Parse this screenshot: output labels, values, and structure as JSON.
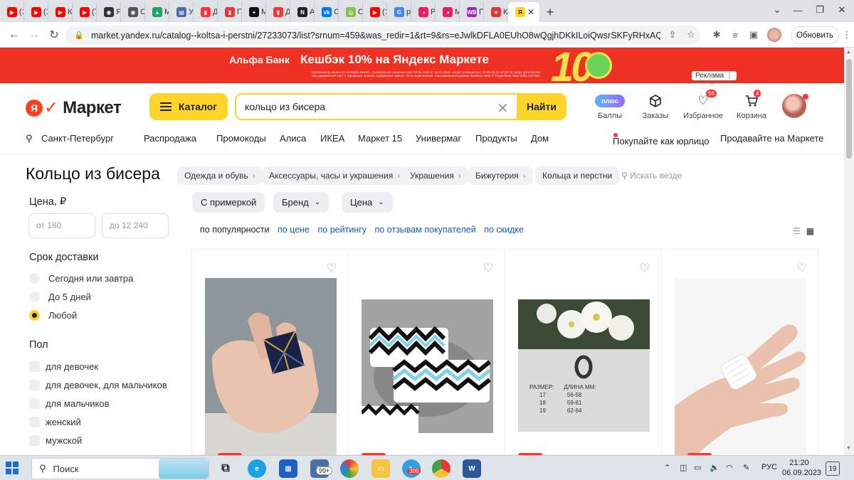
{
  "browser": {
    "tabs": [
      {
        "label": "(1",
        "color": "#ff0000",
        "glyph": "▶"
      },
      {
        "label": "(1",
        "color": "#ff0000",
        "glyph": "▶"
      },
      {
        "label": "Ки",
        "color": "#ff0000",
        "glyph": "▶"
      },
      {
        "label": "(7",
        "color": "#ff0000",
        "glyph": "▶"
      },
      {
        "label": "Ян",
        "color": "#333333",
        "glyph": "◉"
      },
      {
        "label": "Ст",
        "color": "#555555",
        "glyph": "◉"
      },
      {
        "label": "Мо",
        "color": "#1fa463",
        "glyph": "▲"
      },
      {
        "label": "Ус",
        "color": "#4a6fa5",
        "glyph": "▤"
      },
      {
        "label": "Дз",
        "color": "#ff3333",
        "glyph": "▮"
      },
      {
        "label": "П",
        "color": "#e53935",
        "glyph": "▮"
      },
      {
        "label": "М",
        "color": "#111111",
        "glyph": "+"
      },
      {
        "label": "Дз",
        "color": "#ff3333",
        "glyph": "▮"
      },
      {
        "label": "Ал",
        "color": "#222222",
        "glyph": "N"
      },
      {
        "label": "Ог",
        "color": "#0077ff",
        "glyph": "vk"
      },
      {
        "label": "Сл",
        "color": "#8bc34a",
        "glyph": "◎"
      },
      {
        "label": "(1",
        "color": "#ff0000",
        "glyph": "▶"
      },
      {
        "label": "pl",
        "color": "#4285f4",
        "glyph": "G"
      },
      {
        "label": "PI",
        "color": "#e91e63",
        "glyph": "◑"
      },
      {
        "label": "Мо",
        "color": "#e91e63",
        "glyph": "◑"
      },
      {
        "label": "Пл",
        "color": "#9c27b0",
        "glyph": "WB"
      },
      {
        "label": "Ку",
        "color": "#e53935",
        "glyph": "♥"
      }
    ],
    "active_tab_glyph": "Я",
    "new_tab": "+",
    "url": "market.yandex.ru/catalog--koltsa-i-perstni/27233073/list?srnum=459&was_redir=1&rt=9&rs=eJwlkDFLA0EUhO8wQgjhDKkILoiQwsrSKFyRHxAQG...",
    "update_label": "Обновить"
  },
  "banner": {
    "bank": "Альфа Банк",
    "headline": "Кешбэк 10% на Яндекс Маркете",
    "fine_print": "Организатор акции АО «АЛЬФА-БАНК». Генеральная лицензия ЦБ РФ № 1326 от 16.01.2015. Акция проводится с 10.08.23 по 10.09.23 среди физических лиц-держателей карт с тарифным планом «Цифровые карты». Есть ограничения. Максимальный размер кешбэка 3000 Р. Подробнее https://alfa.me/YaM",
    "big_number": "10",
    "ad_label": "Реклама ⋮"
  },
  "header": {
    "logo": "Маркет",
    "catalog_label": "Каталог",
    "search_value": "кольцо из бисера",
    "search_button": "Найти",
    "plus_label": "плюс",
    "points_label": "Баллы",
    "orders_label": "Заказы",
    "favorites_label": "Избранное",
    "favorites_count": "56",
    "cart_label": "Корзина",
    "cart_count": "4"
  },
  "nav": {
    "city": "Санкт-Петербург",
    "links": [
      "Распродажа",
      "Промокоды",
      "Алиса",
      "ИКЕА",
      "Маркет 15",
      "Универмаг",
      "Продукты",
      "Дом"
    ],
    "business": "Покупайте как юрлицо",
    "sell": "Продавайте на Маркете"
  },
  "page": {
    "title": "Кольцо из бисера",
    "breadcrumbs": [
      "Одежда и обувь",
      "Аксессуары, часы и украшения",
      "Украшения",
      "Бижутерия",
      "Кольца и перстни"
    ],
    "search_everywhere": "Искать везде"
  },
  "sidebar": {
    "price_heading": "Цена, ₽",
    "price_from": "от 180",
    "price_to": "до 12 240",
    "delivery_heading": "Срок доставки",
    "delivery_options": [
      "Сегодня или завтра",
      "До 5 дней",
      "Любой"
    ],
    "delivery_selected": "Любой",
    "gender_heading": "Пол",
    "gender_options": [
      "для девочек",
      "для девочек, для мальчиков",
      "для мальчиков",
      "женский",
      "мужской"
    ]
  },
  "filters": {
    "try_on": "С примеркой",
    "brand": "Бренд",
    "price": "Цена",
    "sort_options": [
      "по популярности",
      "по цене",
      "по рейтингу",
      "по отзывам покупателей",
      "по скидке"
    ],
    "sort_active": "по популярности"
  },
  "products": {
    "card3_sizes": {
      "col1_header": "РАЗМЕР:",
      "col2_header": "ДЛИНА ММ:",
      "rows": [
        [
          "17",
          "56-58"
        ],
        [
          "18",
          "59-61"
        ],
        [
          "19",
          "62-64"
        ]
      ]
    }
  },
  "taskbar": {
    "search_label": "Поиск",
    "mail_badge": "99+",
    "telegram_badge": "309",
    "language": "РУС",
    "time": "21:20",
    "date": "06.09.2023",
    "notifications": "19"
  }
}
